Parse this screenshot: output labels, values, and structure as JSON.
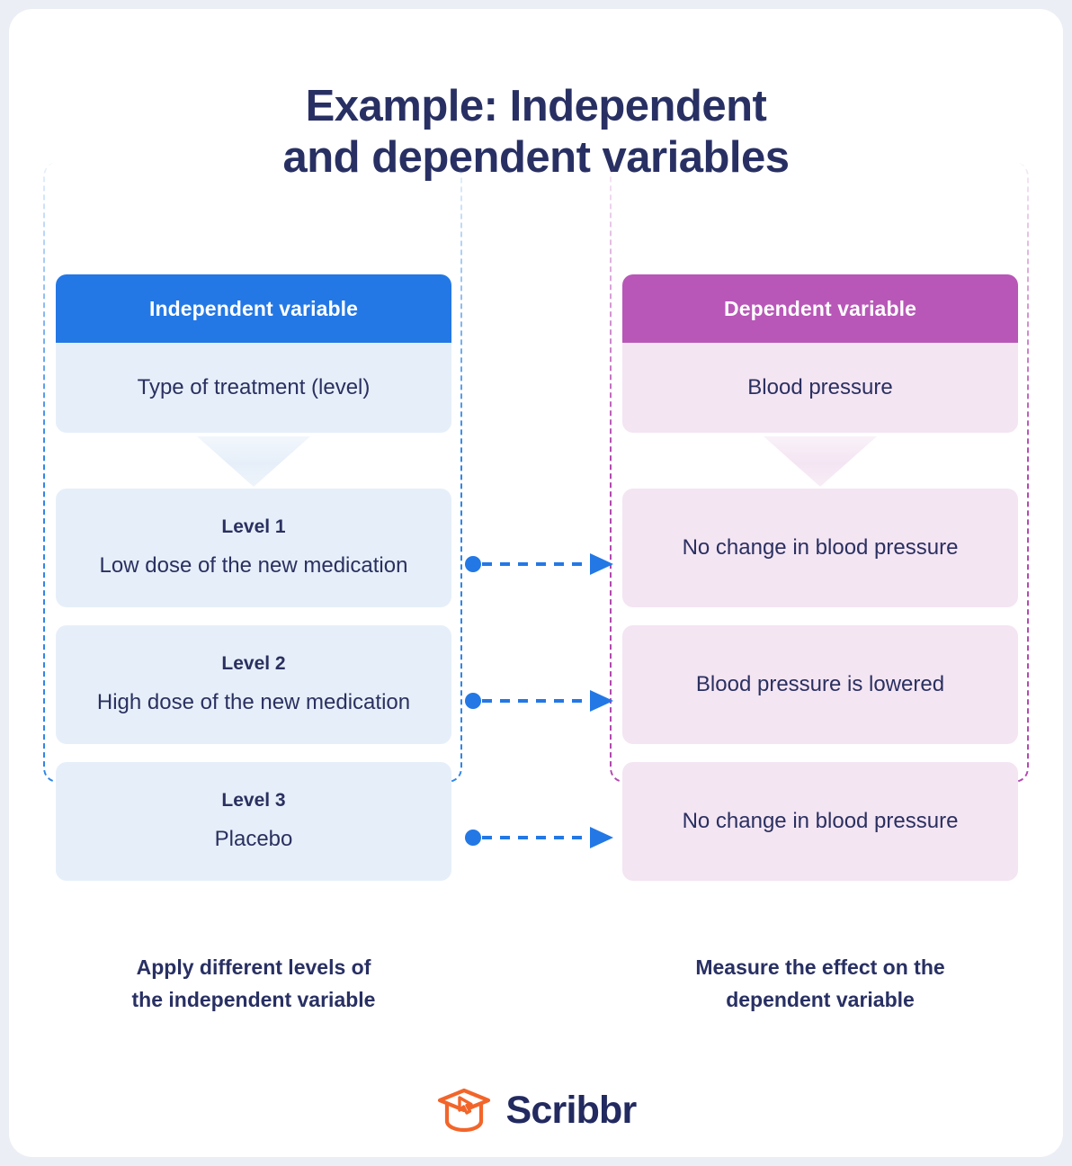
{
  "page": {
    "title_line1": "Example: Independent",
    "title_line2": "and dependent variables",
    "background_color": "#eceef6",
    "card_color": "#ffffff",
    "text_color": "#283063"
  },
  "independent": {
    "header": "Independent variable",
    "header_color": "#2378e5",
    "body_color": "#e6eff9",
    "subject": "Type of treatment (level)",
    "caption_line1": "Apply different levels of",
    "caption_line2": "the independent variable",
    "levels": [
      {
        "title": "Level 1",
        "text": "Low dose of the new medication"
      },
      {
        "title": "Level 2",
        "text": "High dose of the new medication"
      },
      {
        "title": "Level 3",
        "text": "Placebo"
      }
    ]
  },
  "dependent": {
    "header": "Dependent variable",
    "header_color": "#b857b8",
    "body_color": "#f4e5f3",
    "subject": "Blood pressure",
    "caption_line1": "Measure the effect on the",
    "caption_line2": "dependent variable",
    "outcomes": [
      {
        "text": "No change in blood pressure"
      },
      {
        "text": "Blood pressure is lowered"
      },
      {
        "text": "No change in blood pressure"
      }
    ]
  },
  "connectors": {
    "color": "#2378e5",
    "count": 3
  },
  "brand": {
    "name": "Scribbr",
    "logo_color": "#f2652a",
    "text_color": "#222a5f"
  }
}
